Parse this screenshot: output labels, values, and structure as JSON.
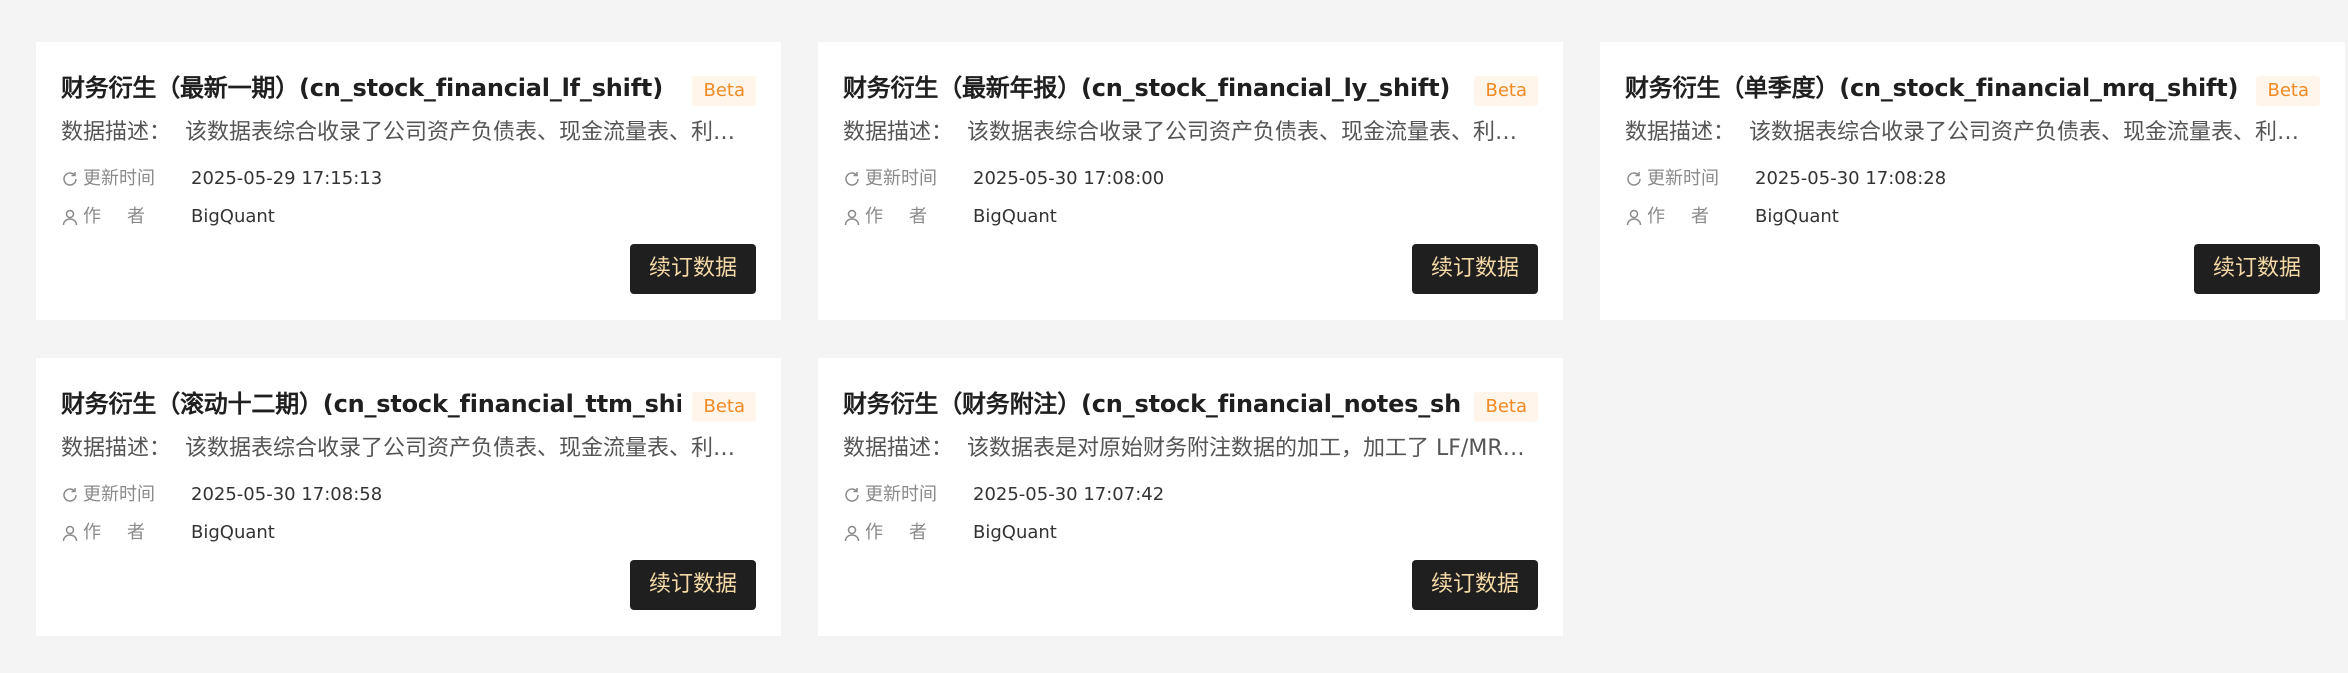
{
  "cards": [
    {
      "title": "财务衍生（最新一期）(cn_stock_financial_lf_shift)",
      "badge": "Beta",
      "desc_label": "数据描述：",
      "desc_text": "该数据表综合收录了公司资产负债表、现金流量表、利润表的财务数据，并进行了衍生计算",
      "updated_label": "更新时间",
      "updated_value": "2025-05-29 17:15:13",
      "author_label": "作者",
      "author_value": "BigQuant",
      "button": "续订数据"
    },
    {
      "title": "财务衍生（最新年报）(cn_stock_financial_ly_shift)",
      "badge": "Beta",
      "desc_label": "数据描述：",
      "desc_text": "该数据表综合收录了公司资产负债表、现金流量表、利润表的财务数据，并进行了衍生计算",
      "updated_label": "更新时间",
      "updated_value": "2025-05-30 17:08:00",
      "author_label": "作者",
      "author_value": "BigQuant",
      "button": "续订数据"
    },
    {
      "title": "财务衍生（单季度）(cn_stock_financial_mrq_shift)",
      "badge": "Beta",
      "desc_label": "数据描述：",
      "desc_text": "该数据表综合收录了公司资产负债表、现金流量表、利润表的财务数据，并进行了衍生计算",
      "updated_label": "更新时间",
      "updated_value": "2025-05-30 17:08:28",
      "author_label": "作者",
      "author_value": "BigQuant",
      "button": "续订数据"
    },
    {
      "title": "财务衍生（滚动十二期）(cn_stock_financial_ttm_shift)",
      "badge": "Beta",
      "desc_label": "数据描述：",
      "desc_text": "该数据表综合收录了公司资产负债表、现金流量表、利润表的财务数据，并进行了衍生计算",
      "updated_label": "更新时间",
      "updated_value": "2025-05-30 17:08:58",
      "author_label": "作者",
      "author_value": "BigQuant",
      "button": "续订数据"
    },
    {
      "title": "财务衍生（财务附注）(cn_stock_financial_notes_shift)",
      "badge": "Beta",
      "desc_label": "数据描述：",
      "desc_text": "该数据表是对原始财务附注数据的加工，加工了 LF/MRQ/LY/TTM 等衍生数据",
      "updated_label": "更新时间",
      "updated_value": "2025-05-30 17:07:42",
      "author_label": "作者",
      "author_value": "BigQuant",
      "button": "续订数据"
    }
  ],
  "colors": {
    "page_bg": "#f4f4f4",
    "card_bg": "#ffffff",
    "badge_text": "#f08a24",
    "badge_bg": "#fff5ea",
    "button_bg": "#1f1f1f",
    "button_text": "#f5d9a6"
  },
  "icons": {
    "updated": "refresh-icon",
    "author": "user-icon"
  }
}
